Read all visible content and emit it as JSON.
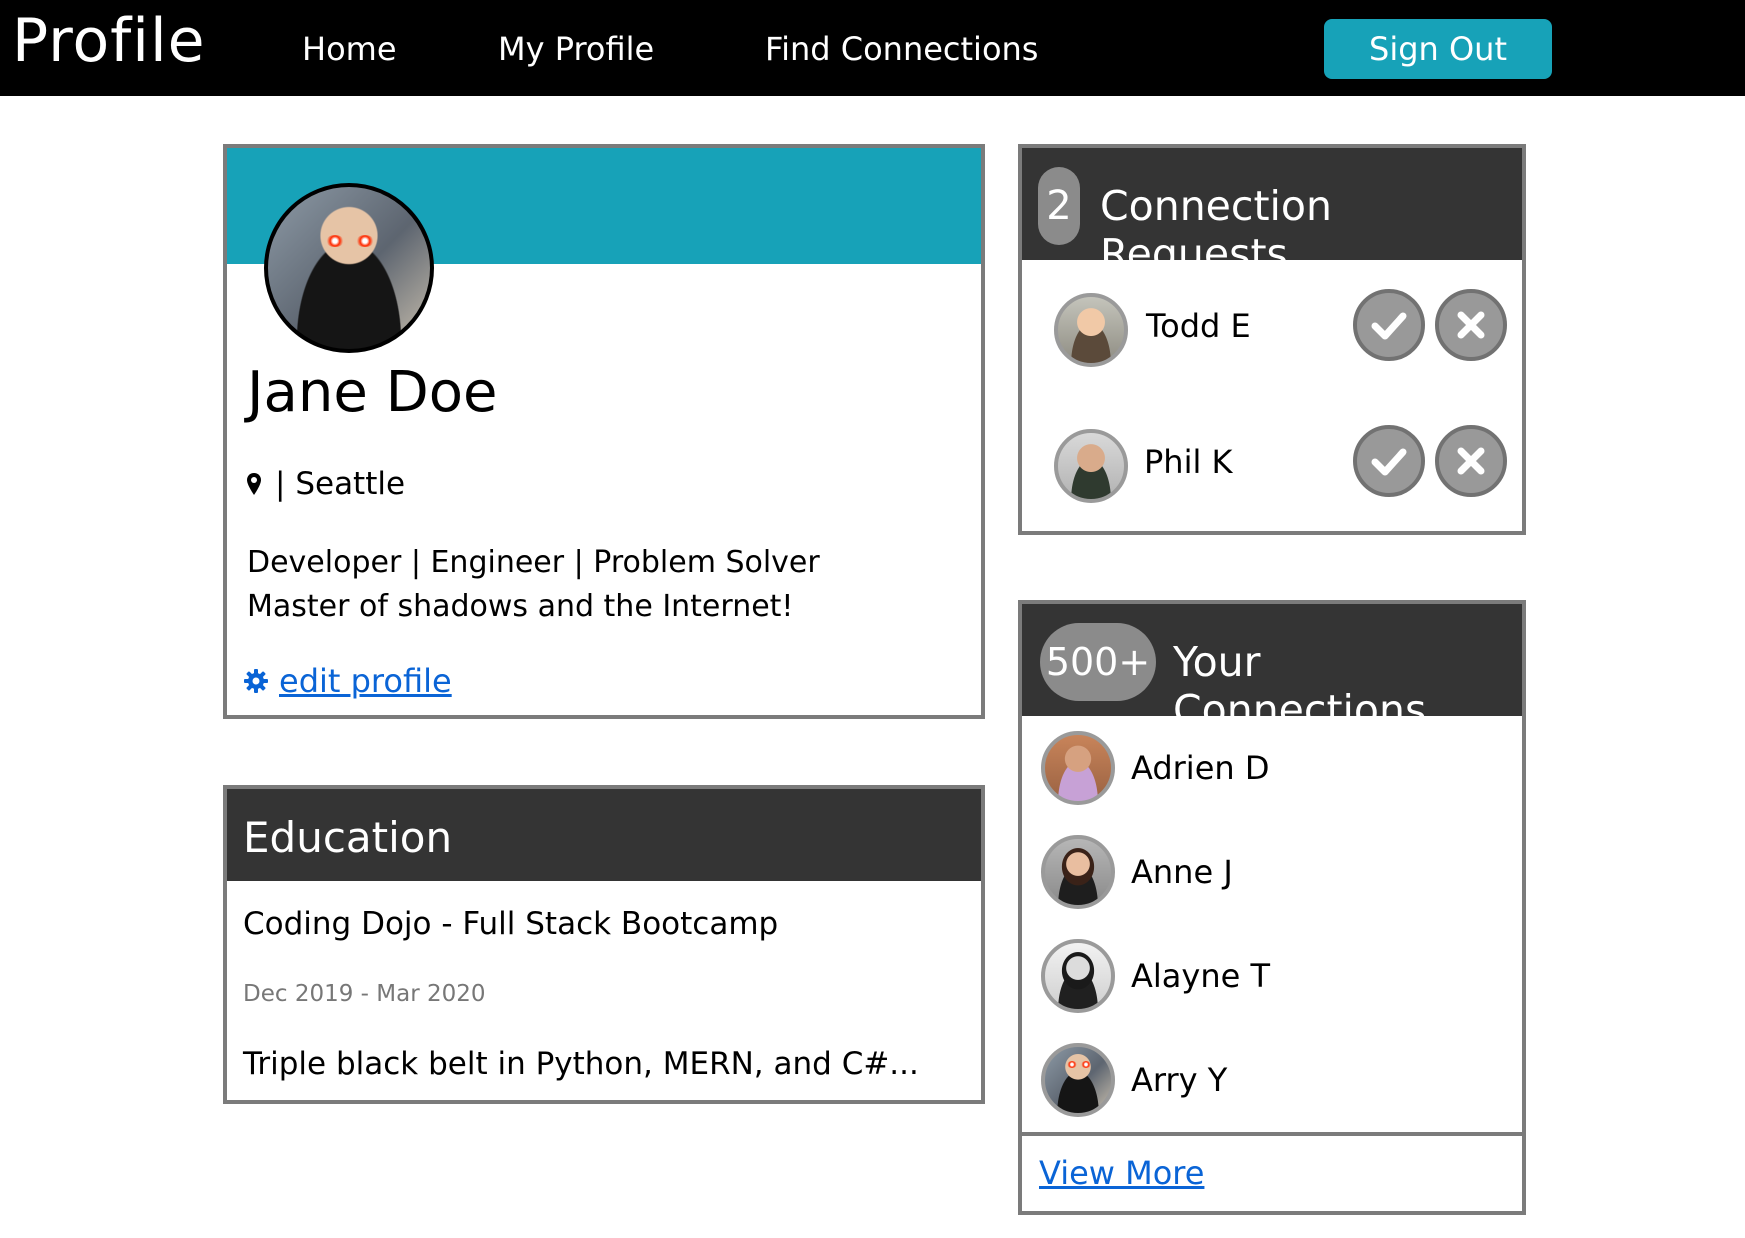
{
  "nav": {
    "brand": "Profile",
    "links": [
      "Home",
      "My Profile",
      "Find Connections"
    ],
    "sign_out": "Sign Out"
  },
  "profile": {
    "name": "Jane Doe",
    "location_prefix": "| ",
    "location": "Seattle",
    "bio_line1": "Developer | Engineer | Problem Solver",
    "bio_line2": "Master of shadows and the Internet!",
    "edit_link": "edit profile"
  },
  "education": {
    "title": "Education",
    "school": "Coding Dojo - Full Stack Bootcamp",
    "dates": "Dec 2019 - Mar 2020",
    "description": "Triple black belt in Python, MERN, and C#..."
  },
  "requests": {
    "count": "2",
    "title": "Connection Requests",
    "items": [
      {
        "name": "Todd E"
      },
      {
        "name": "Phil K"
      }
    ]
  },
  "connections": {
    "count": "500+",
    "title": "Your Connections",
    "items": [
      {
        "name": "Adrien D"
      },
      {
        "name": "Anne J"
      },
      {
        "name": "Alayne T"
      },
      {
        "name": "Arry Y"
      }
    ],
    "view_more": "View More"
  },
  "colors": {
    "accent": "#17a2b8",
    "nav_bg": "#000000",
    "card_header": "#343434",
    "card_border": "#7b7b7b",
    "link": "#0a64d6",
    "badge": "#8b8b8b"
  },
  "icons": [
    "map-pin-icon",
    "gear-icon",
    "check-icon",
    "x-icon"
  ]
}
